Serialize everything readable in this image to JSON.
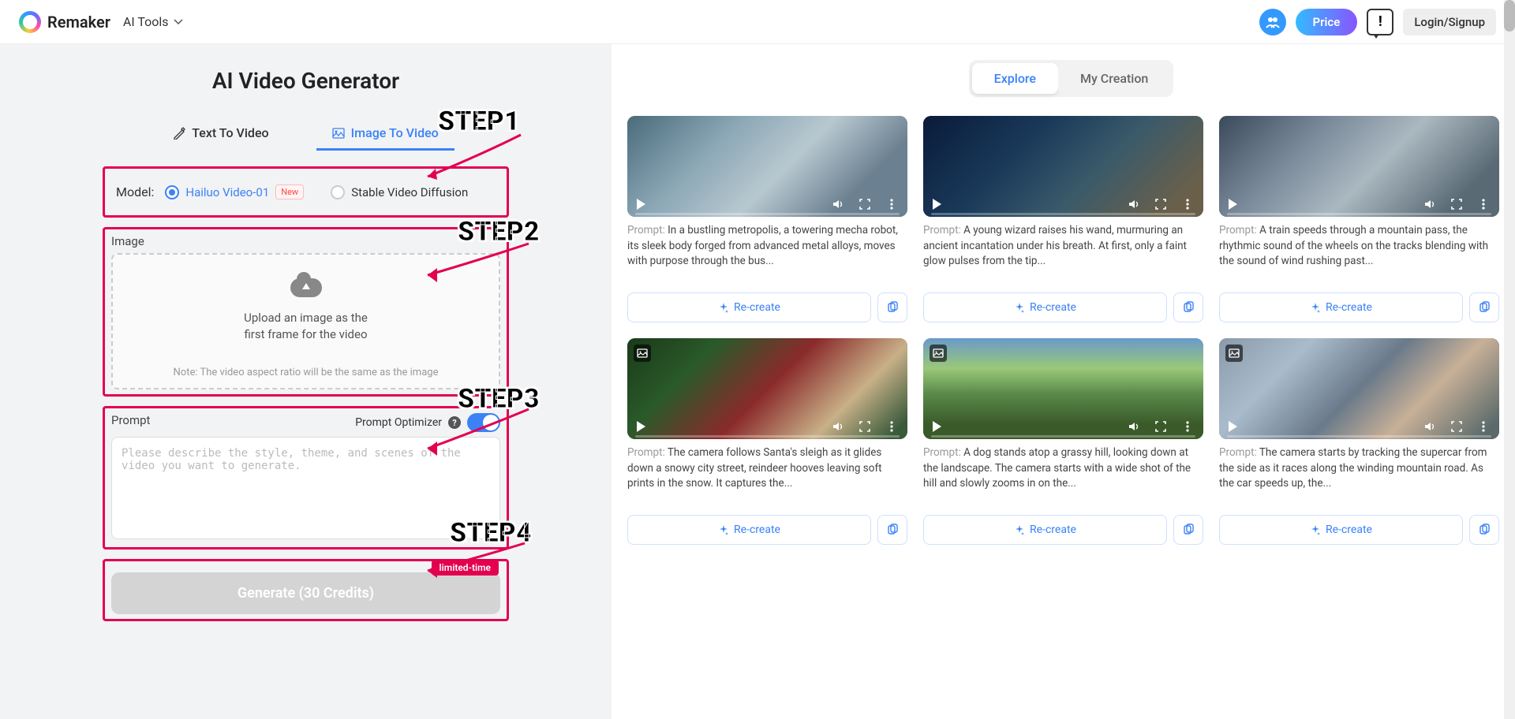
{
  "header": {
    "brand": "Remaker",
    "aiTools": "AI Tools",
    "price": "Price",
    "login": "Login/Signup"
  },
  "steps": {
    "s1": "STEP1",
    "s2": "STEP2",
    "s3": "STEP3",
    "s4": "STEP4"
  },
  "left": {
    "title": "AI Video Generator",
    "tab1": "Text To Video",
    "tab2": "Image To Video",
    "modelLabel": "Model:",
    "model1": "Hailuo Video-01",
    "model1Badge": "New",
    "model2": "Stable Video Diffusion",
    "imageLabel": "Image",
    "uploadLine1": "Upload an image as the",
    "uploadLine2": "first frame for the video",
    "uploadNote": "Note: The video aspect ratio will be the same as the image",
    "promptLabel": "Prompt",
    "optimizerLabel": "Prompt Optimizer",
    "promptPlaceholder": "Please describe the style, theme, and scenes of the video you want to generate.",
    "limitedBadge": "limited-time",
    "generate": "Generate (30 Credits)"
  },
  "right": {
    "tab1": "Explore",
    "tab2": "My Creation",
    "promptPrefix": "Prompt: ",
    "recreate": "Re-create",
    "cards": [
      {
        "desc": "In a bustling metropolis, a towering mecha robot, its sleek body forged from advanced metal alloys, moves with purpose through the bus...",
        "hasBadge": false,
        "bg": "linear-gradient(135deg,#4a6b7a 0%,#8aa6b5 30%,#b8c8d0 55%,#6b8090 80%)"
      },
      {
        "desc": "A young wizard raises his wand, murmuring an ancient incantation under his breath. At first, only a faint glow pulses from the tip...",
        "hasBadge": false,
        "bg": "linear-gradient(135deg,#0a1a3a 0%,#1a3a5a 35%,#3a5a6a 60%,#6a604a 90%)"
      },
      {
        "desc": "A train speeds through a mountain pass, the rhythmic sound of the wheels on the tracks blending with the sound of wind rushing past...",
        "hasBadge": false,
        "bg": "linear-gradient(135deg,#3a4a5a 0%,#7a8a9a 30%,#aab8c0 55%,#5a6a75 85%)"
      },
      {
        "desc": "The camera follows Santa's sleigh as it glides down a snowy city street, reindeer hooves leaving soft prints in the snow. It captures the...",
        "hasBadge": true,
        "bg": "linear-gradient(135deg,#1a3a1a 0%,#2a5a2a 25%,#8a2a2a 50%,#c8b088 75%,#3a5a3a 95%)"
      },
      {
        "desc": "A dog stands atop a grassy hill, looking down at the landscape. The camera starts with a wide shot of the hill and slowly zooms in on the...",
        "hasBadge": true,
        "bg": "linear-gradient(180deg,#6a9aca 0%,#9ac878 30%,#5a8a4a 55%,#3a5a2a 85%)"
      },
      {
        "desc": "The camera starts by tracking the supercar from the side as it races along the winding mountain road. As the car speeds up, the...",
        "hasBadge": true,
        "bg": "linear-gradient(135deg,#8a9aaa 0%,#aabbcc 25%,#6a7a8a 50%,#c8b098 70%,#5a6a6a 95%)"
      }
    ]
  }
}
